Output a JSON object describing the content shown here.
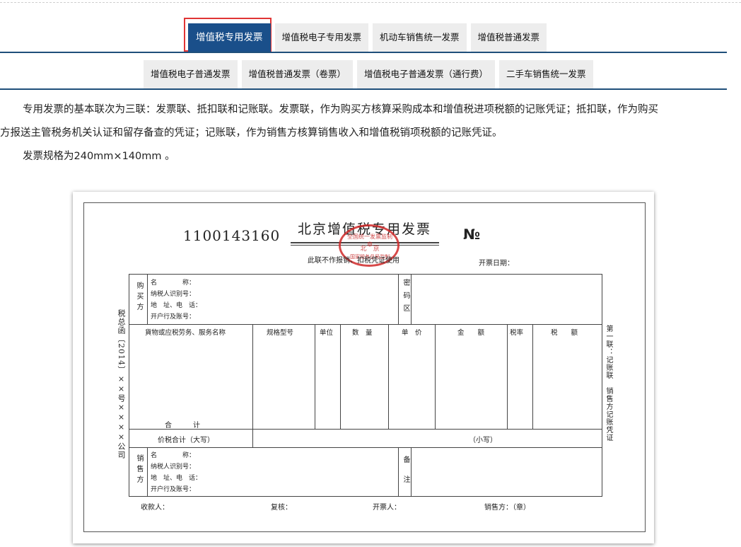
{
  "tabs_row1": [
    {
      "label": "增值税专用发票",
      "active": true
    },
    {
      "label": "增值税电子专用发票",
      "active": false
    },
    {
      "label": "机动车销售统一发票",
      "active": false
    },
    {
      "label": "增值税普通发票",
      "active": false
    }
  ],
  "tabs_row2": [
    {
      "label": "增值税电子普通发票"
    },
    {
      "label": "增值税普通发票（卷票）"
    },
    {
      "label": "增值税电子普通发票（通行费）"
    },
    {
      "label": "二手车销售统一发票"
    }
  ],
  "description": {
    "line1": "专用发票的基本联次为三联：发票联、抵扣联和记账联。发票联，作为购买方核算采购成本和增值税进项税额的记账凭证；抵扣联，作为购买",
    "line2": "方报送主管税务机关认证和留存备查的凭证；记账联，作为销售方核算销售收入和增值税销项税额的记账凭证。",
    "spec": "发票规格为240mm×140mm 。"
  },
  "invoice": {
    "code": "1100143160",
    "title": "北京增值税专用发票",
    "number_mark": "№",
    "note": "此联不作报销、扣税凭证使用",
    "date_label": "开票日期：",
    "stamp_text": "全国统一发票监制章",
    "stamp_city": "北　京",
    "stamp_org": "国家税务总局监制",
    "buyer_label": "购买方",
    "fields": [
      "名　　　　称：",
      "纳税人识别号：",
      "地　址、电　话：",
      "开户行及账号："
    ],
    "cipher_label": "密码区",
    "columns": [
      "貨物或应税劳务、服务名称",
      "规格型号",
      "单位",
      "数　量",
      "单　价",
      "金　　额",
      "税率",
      "税　　额"
    ],
    "total_label": "合　　　计",
    "tax_total_label": "价税合计（大写）",
    "small_label": "（小写）",
    "seller_label": "销售方",
    "remark_label": "备注",
    "footer": [
      "收款人：",
      "复核：",
      "开票人：",
      "销售方：（章）"
    ],
    "side_right": "第一联：记账联　销售方记账凭证",
    "side_left": "税总函〔2014〕××号××××公司"
  }
}
